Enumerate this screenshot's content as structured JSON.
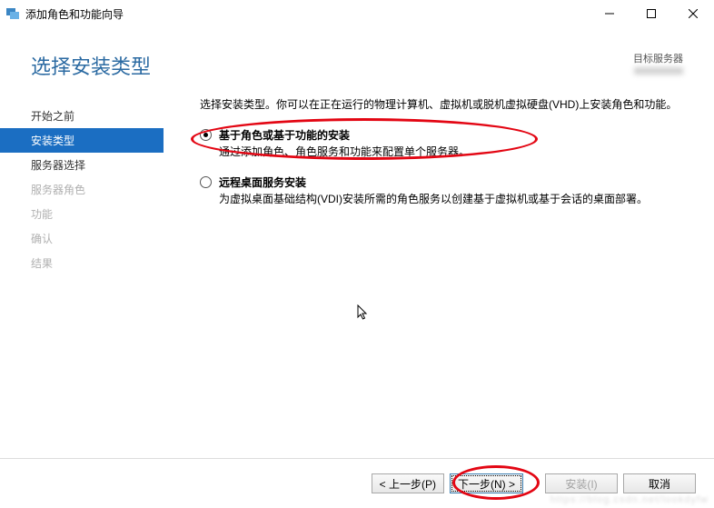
{
  "window": {
    "title": "添加角色和功能向导"
  },
  "header": {
    "title": "选择安装类型",
    "target_label": "目标服务器"
  },
  "sidebar": {
    "items": [
      {
        "label": "开始之前",
        "state": "normal"
      },
      {
        "label": "安装类型",
        "state": "selected"
      },
      {
        "label": "服务器选择",
        "state": "normal"
      },
      {
        "label": "服务器角色",
        "state": "disabled"
      },
      {
        "label": "功能",
        "state": "disabled"
      },
      {
        "label": "确认",
        "state": "disabled"
      },
      {
        "label": "结果",
        "state": "disabled"
      }
    ]
  },
  "content": {
    "instruction": "选择安装类型。你可以在正在运行的物理计算机、虚拟机或脱机虚拟硬盘(VHD)上安装角色和功能。",
    "options": [
      {
        "title": "基于角色或基于功能的安装",
        "desc": "通过添加角色、角色服务和功能来配置单个服务器。",
        "checked": true
      },
      {
        "title": "远程桌面服务安装",
        "desc": "为虚拟桌面基础结构(VDI)安装所需的角色服务以创建基于虚拟机或基于会话的桌面部署。",
        "checked": false
      }
    ]
  },
  "footer": {
    "prev": "< 上一步(P)",
    "next": "下一步(N) >",
    "install": "安装(I)",
    "cancel": "取消"
  }
}
